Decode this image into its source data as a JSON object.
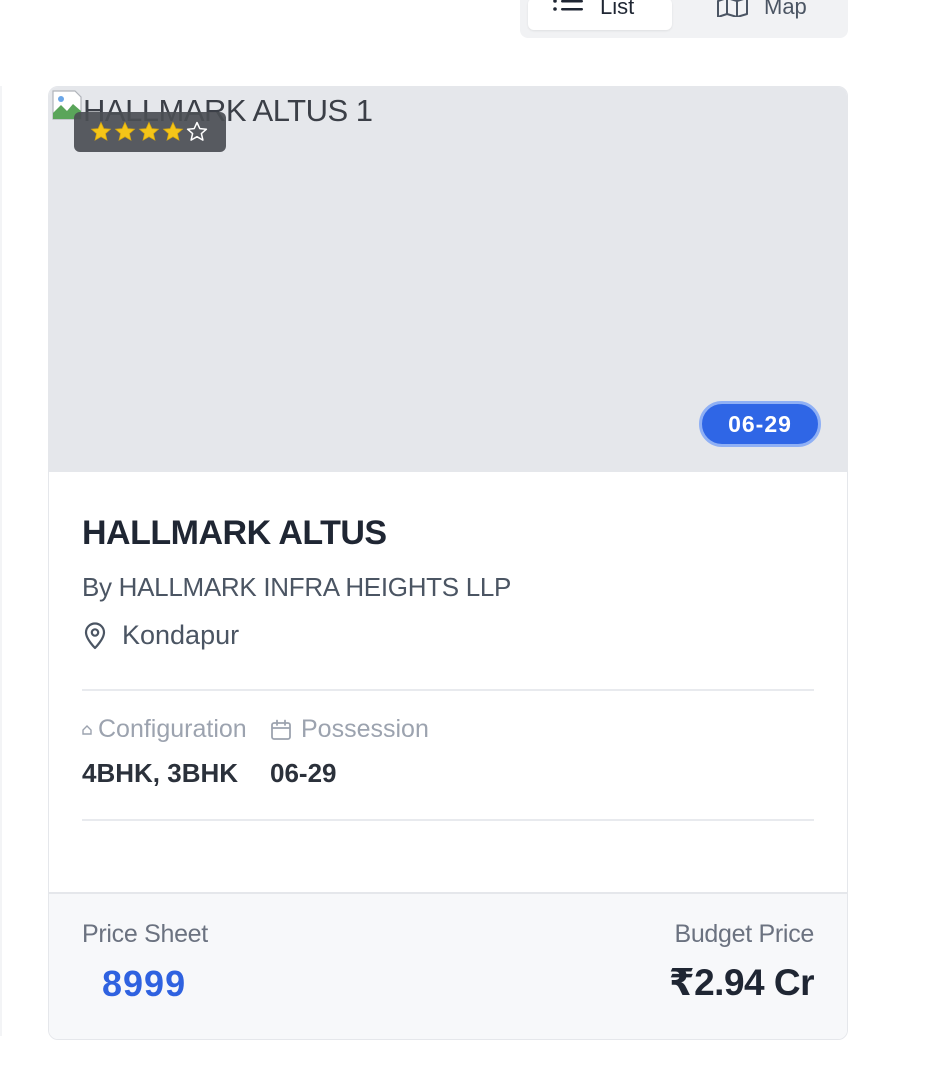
{
  "view_toggle": {
    "list_label": "List",
    "map_label": "Map",
    "active": "List",
    "list_icon": "list-icon",
    "map_icon": "map-icon"
  },
  "card": {
    "image_alt": "HALLMARK ALTUS 1",
    "rating": 4,
    "rating_max": 5,
    "date_badge": "06-29",
    "title": "HALLMARK ALTUS",
    "developer": "By HALLMARK INFRA HEIGHTS LLP",
    "location": "Kondapur",
    "location_icon": "map-pin-icon",
    "specs": {
      "configuration_label": "Configuration",
      "configuration_value": "4BHK, 3BHK",
      "possession_label": "Possession",
      "possession_value": "06-29"
    },
    "footer": {
      "price_sheet_label": "Price Sheet",
      "price_sheet_value": "8999",
      "budget_label": "Budget Price",
      "budget_value": "₹2.94 Cr"
    }
  },
  "colors": {
    "accent": "#2f66e6",
    "star": "#f5c518",
    "badge_bg": "#4b4e54",
    "image_placeholder": "#e5e7eb"
  }
}
